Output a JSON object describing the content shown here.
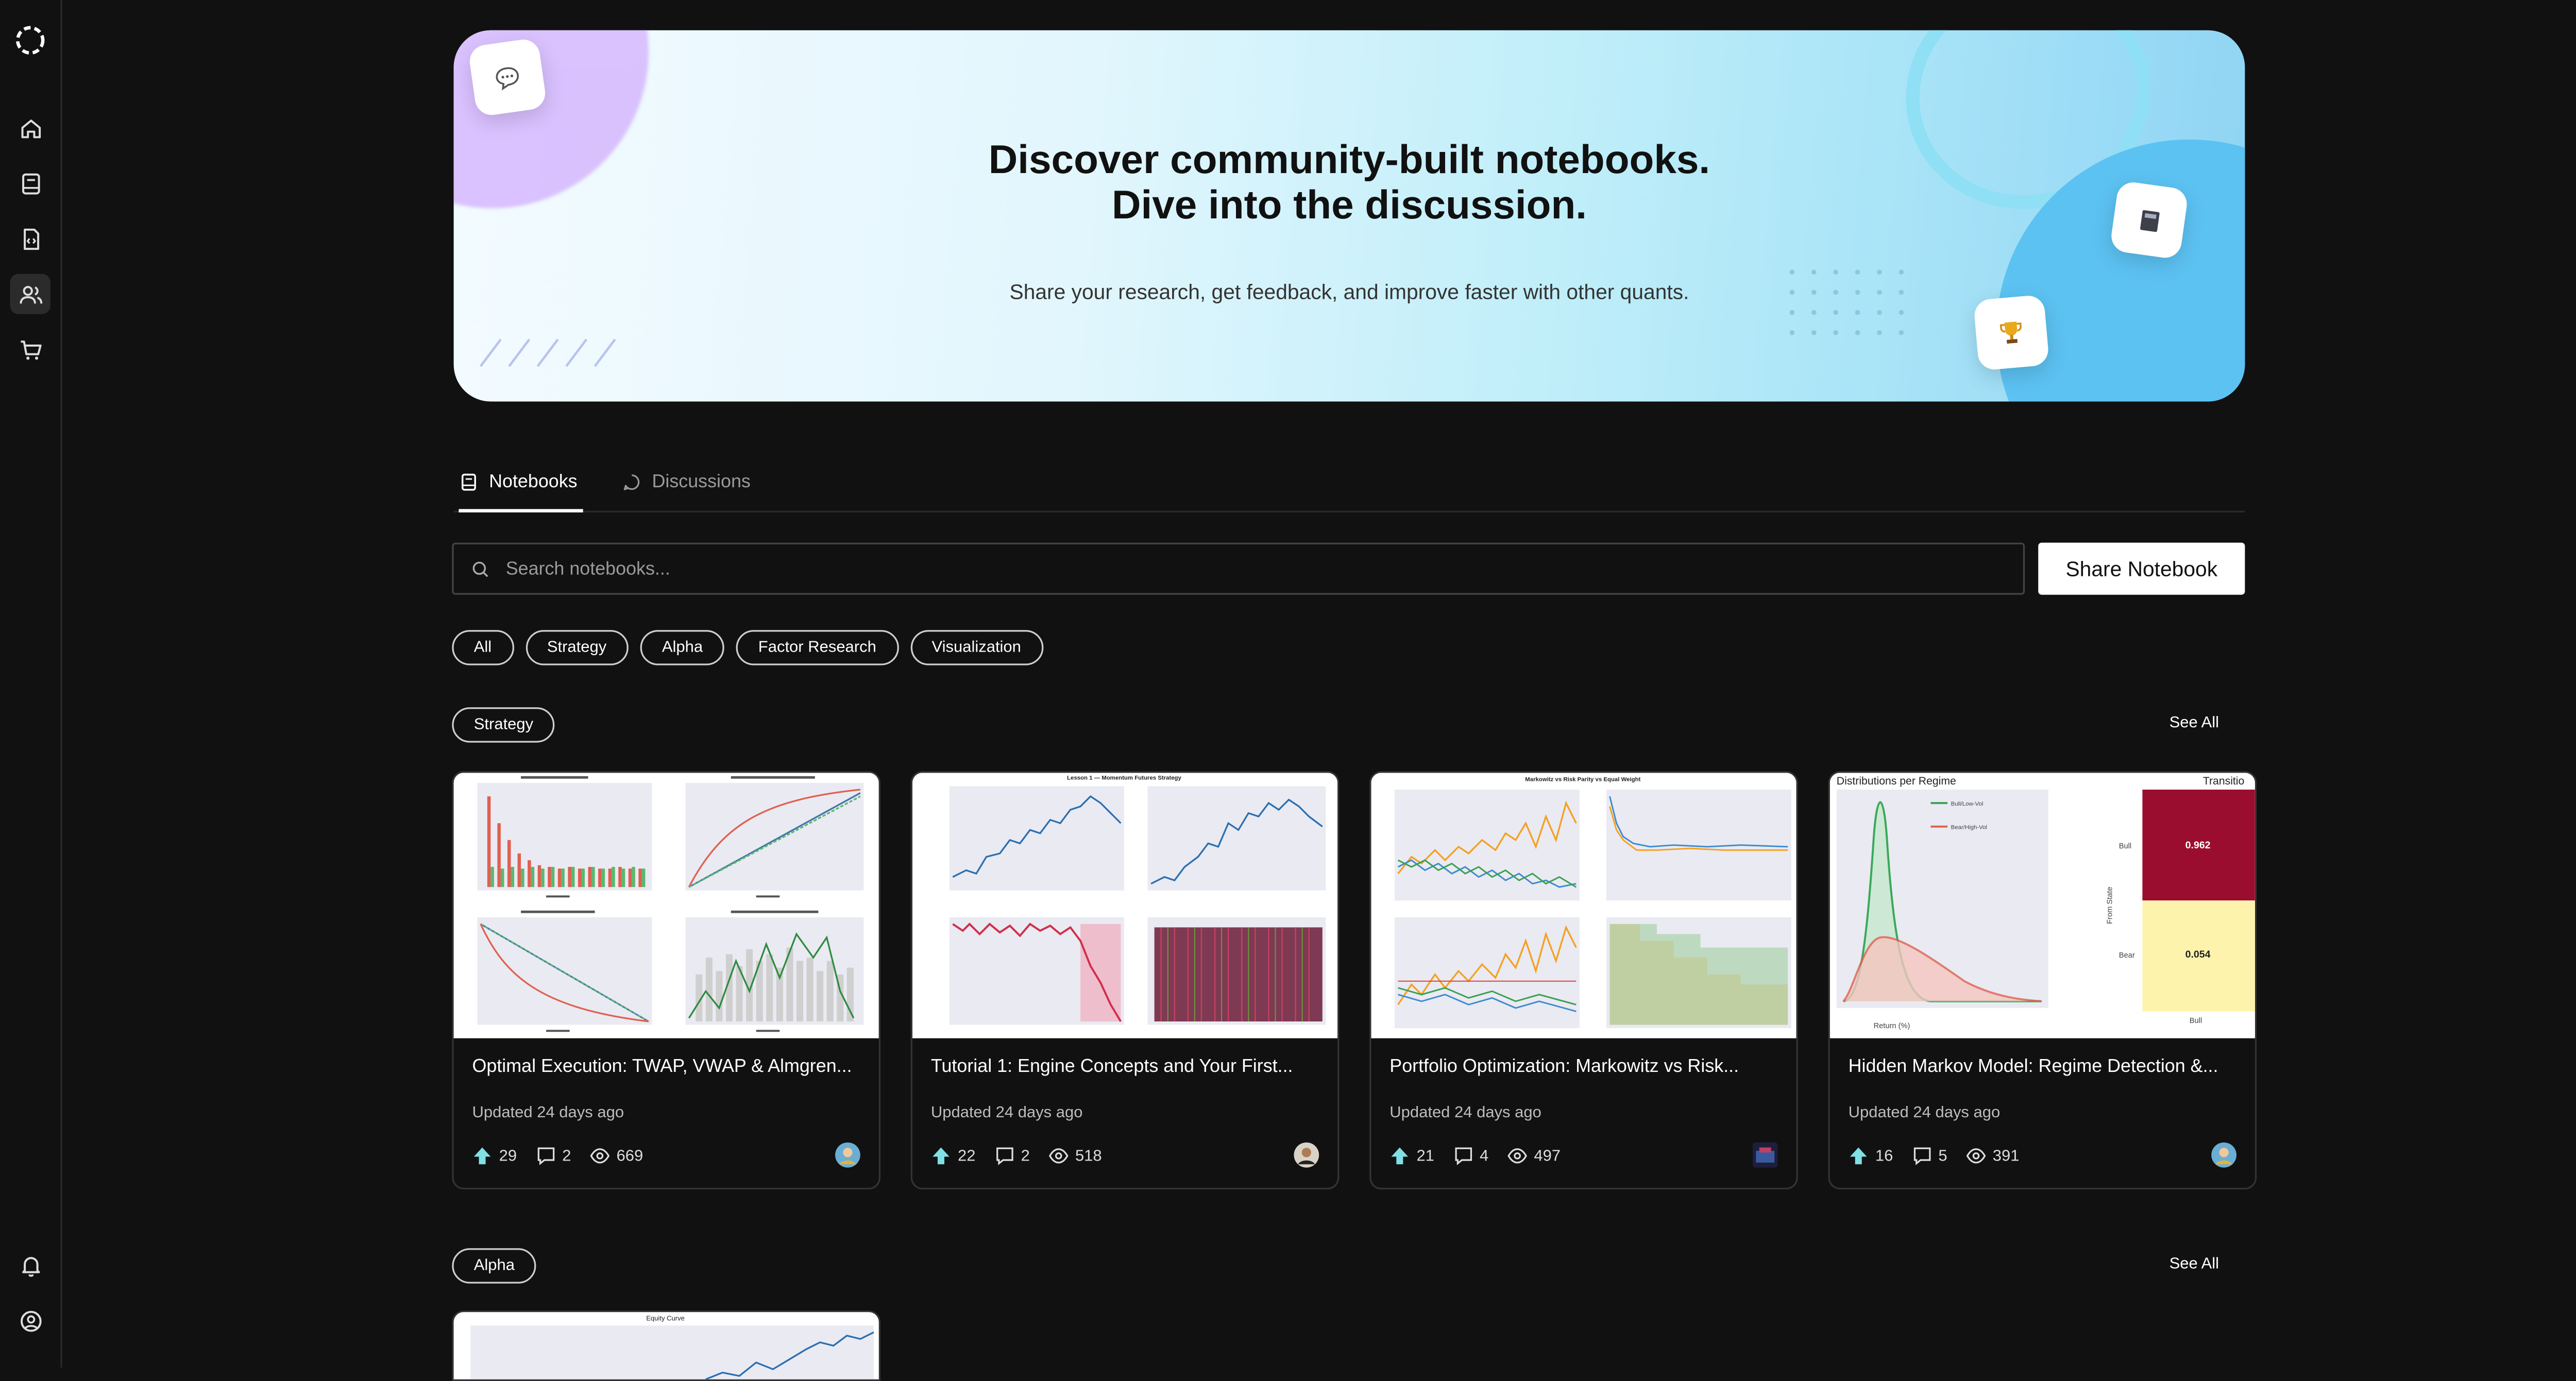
{
  "hero": {
    "title_line1": "Discover community-built notebooks.",
    "title_line2": "Dive into the discussion.",
    "subtitle": "Share your research, get feedback, and improve faster with other quants."
  },
  "tabs": [
    {
      "label": "Notebooks",
      "active": true
    },
    {
      "label": "Discussions",
      "active": false
    }
  ],
  "search": {
    "placeholder": "Search notebooks...",
    "value": ""
  },
  "share_button": "Share Notebook",
  "filters": [
    "All",
    "Strategy",
    "Alpha",
    "Factor Research",
    "Visualization"
  ],
  "sections": [
    {
      "name": "Strategy",
      "see_all": "See All",
      "cards": [
        {
          "title": "Optimal Execution: TWAP, VWAP & Almgren...",
          "updated": "Updated 24 days ago",
          "upvotes": "29",
          "comments": "2",
          "views": "669"
        },
        {
          "title": "Tutorial 1: Engine Concepts and Your First...",
          "updated": "Updated 24 days ago",
          "upvotes": "22",
          "comments": "2",
          "views": "518"
        },
        {
          "title": "Portfolio Optimization: Markowitz vs Risk...",
          "updated": "Updated 24 days ago",
          "upvotes": "21",
          "comments": "4",
          "views": "497"
        },
        {
          "title": "Hidden Markov Model: Regime Detection &...",
          "updated": "Updated 24 days ago",
          "upvotes": "16",
          "comments": "5",
          "views": "391"
        }
      ]
    },
    {
      "name": "Alpha",
      "see_all": "See All"
    }
  ],
  "thumbnails": {
    "card2_title": "Lesson 1 — Momentum Futures Strategy",
    "card3_title": "Markowitz vs Risk Parity vs Equal Weight",
    "card4_title": "Distributions per Regime",
    "card4_right_title": "Transitio",
    "card4_bull": "Bull",
    "card4_bear": "Bear",
    "card4_val1": "0.962",
    "card4_val2": "0.054",
    "card4_xlabel": "Return (%)",
    "card4_ylabel": "From State",
    "card4_legend1": "Bull/Low-Vol",
    "card4_legend2": "Bear/High-Vol",
    "partial_title": "Equity Curve"
  },
  "colors": {
    "upvote": "#7fe0e6",
    "accent": "#ffffff",
    "hero_purple": "#d6b8ff",
    "hero_blue": "#5cc2f2"
  },
  "icons": {
    "sidebar": [
      "logo-icon",
      "home-icon",
      "notebook-icon",
      "code-file-icon",
      "community-icon",
      "cart-icon",
      "bell-icon",
      "account-icon"
    ],
    "hero_tiles": [
      "chat-icon",
      "book-icon",
      "trophy-icon"
    ]
  }
}
